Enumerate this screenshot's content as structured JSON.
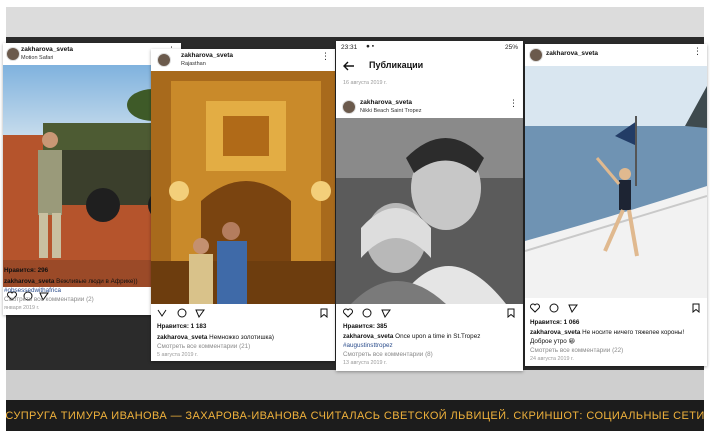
{
  "caption": "Супруга Тимура Иванова — Захарова-Иванова считалась светской львицей. Скриншот: социальные сети",
  "colors": {
    "caption_text": "#f0b23c",
    "caption_bg": "#1c1c1c",
    "hashtag": "#2b4d8c"
  },
  "posts": [
    {
      "username": "zakharova_sveta",
      "location": "Motion Safari",
      "likes": "Нравится: 296",
      "caption_user": "zakharova_sveta",
      "caption_text": " Вежливые люди в Африке))",
      "hashtag": "#obsessedwithafrica",
      "comments": "Смотреть все комментарии (2)",
      "date": "января 2019 г."
    },
    {
      "username": "zakharova_sveta",
      "location": "Rajasthan",
      "likes": "Нравится: 1 183",
      "caption_user": "zakharova_sveta",
      "caption_text": " Немножко золотишка)",
      "comments": "Смотреть все комментарии (21)",
      "date": "5 августа 2019 г."
    },
    {
      "status_time": "23:31",
      "status_right": "25%",
      "back_icon": "back-arrow-icon",
      "page_title": "Публикации",
      "date_top": "16 августа 2019 г.",
      "username": "zakharova_sveta",
      "location": "Nikki Beach Saint Tropez",
      "likes": "Нравится: 385",
      "caption_user": "zakharova_sveta",
      "caption_text": " Once upon a time in St.Tropez",
      "hashtag": "#augustinsttropez",
      "comments": "Смотреть все комментарии (8)",
      "date": "13 августа 2019 г."
    },
    {
      "username": "zakharova_sveta",
      "likes": "Нравится: 1 066",
      "caption_user": "zakharova_sveta",
      "caption_text": " Не носите ничего тяжелее короны!",
      "caption_text2": "Доброе утро 😀",
      "comments": "Смотреть все комментарии (22)",
      "date": "24 августа 2019 г."
    }
  ]
}
